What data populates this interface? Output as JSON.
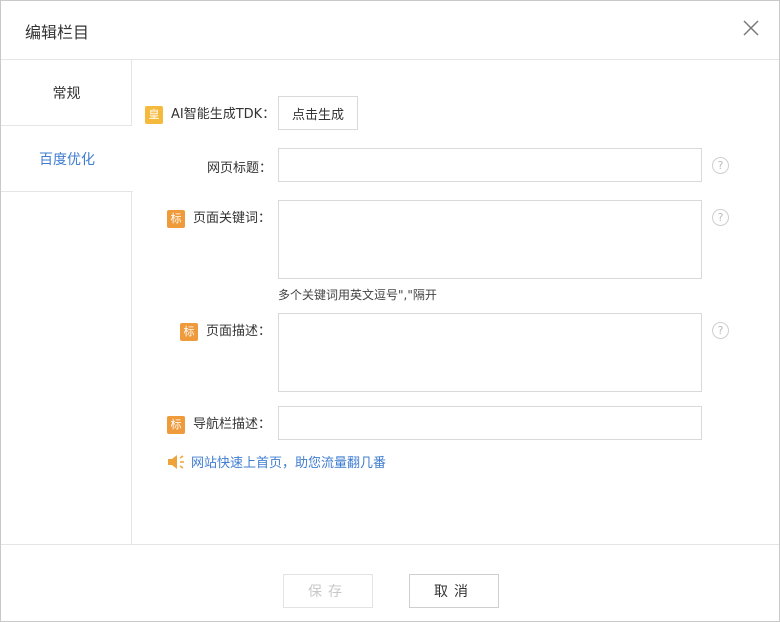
{
  "dialog": {
    "title": "编辑栏目"
  },
  "sidebar": {
    "tabs": [
      {
        "label": "常规"
      },
      {
        "label": "百度优化"
      }
    ]
  },
  "form": {
    "ai": {
      "badge": "皇",
      "label": "AI智能生成TDK：",
      "button": "点击生成"
    },
    "page_title": {
      "label": "网页标题：",
      "value": "",
      "help": "?"
    },
    "keywords": {
      "badge": "标",
      "label": "页面关键词：",
      "value": "",
      "help": "?",
      "hint": "多个关键词用英文逗号\",\"隔开"
    },
    "description": {
      "badge": "标",
      "label": "页面描述：",
      "value": "",
      "help": "?"
    },
    "nav_desc": {
      "badge": "标",
      "label": "导航栏描述：",
      "value": ""
    },
    "promo": {
      "text": "网站快速上首页，助您流量翻几番"
    }
  },
  "footer": {
    "save_label": "保存",
    "cancel_label": "取消"
  },
  "colors": {
    "accent": "#3f7dd1",
    "badge_gold": "#f5b93b",
    "badge_orange": "#ef9a3b"
  }
}
